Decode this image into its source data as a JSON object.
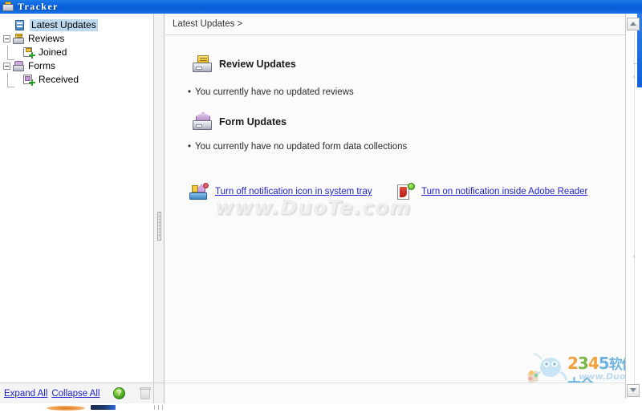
{
  "window": {
    "title": "Tracker",
    "title_icon": "tracker-tray-icon"
  },
  "sidebar": {
    "items": [
      {
        "label": "Latest Updates",
        "icon": "latest-updates-icon",
        "level": 0,
        "selected": true,
        "expander": false
      },
      {
        "label": "Reviews",
        "icon": "reviews-tray-icon",
        "level": 0,
        "selected": false,
        "expander": true
      },
      {
        "label": "Joined",
        "icon": "joined-page-icon",
        "level": 1,
        "selected": false,
        "expander": false
      },
      {
        "label": "Forms",
        "icon": "forms-tray-icon",
        "level": 0,
        "selected": false,
        "expander": true
      },
      {
        "label": "Received",
        "icon": "received-page-icon",
        "level": 1,
        "selected": false,
        "expander": false
      }
    ],
    "footer": {
      "expand_all": "Expand All",
      "collapse_all": "Collapse All",
      "help_label": "?",
      "help_icon": "help-circle-icon",
      "trash_icon": "trash-icon"
    }
  },
  "content": {
    "breadcrumb": "Latest Updates >",
    "sections": [
      {
        "title": "Review Updates",
        "icon": "review-updates-icon",
        "message": "You currently have no updated reviews",
        "bullet": "•"
      },
      {
        "title": "Form Updates",
        "icon": "form-updates-icon",
        "message": "You currently have no updated form data collections",
        "bullet": "•"
      }
    ],
    "links": [
      {
        "text": "Turn off notification icon in system tray",
        "icon": "system-tray-notification-icon"
      },
      {
        "text": "Turn on notification inside Adobe Reader",
        "icon": "adobe-reader-pdf-icon"
      }
    ]
  },
  "watermarks": {
    "center": "www.DuoTe.com",
    "bottom_right": {
      "digits": [
        "2",
        "3",
        "4",
        "5"
      ],
      "cn_suffix": "软件大全",
      "site": "www.DuoTe.com",
      "slogan": "国内最安全的软件站"
    }
  },
  "scrollbar": {
    "up_arrow": "scroll-up-arrow-icon",
    "down_arrow": "scroll-down-arrow-icon",
    "ticks": [
      "–",
      "‹"
    ]
  },
  "colors": {
    "titlebar_start": "#1e7ae8",
    "titlebar_end": "#0a5ed8",
    "link": "#2222cc",
    "selection": "#bcd8ef",
    "accent_blue": "#0c5fda"
  }
}
